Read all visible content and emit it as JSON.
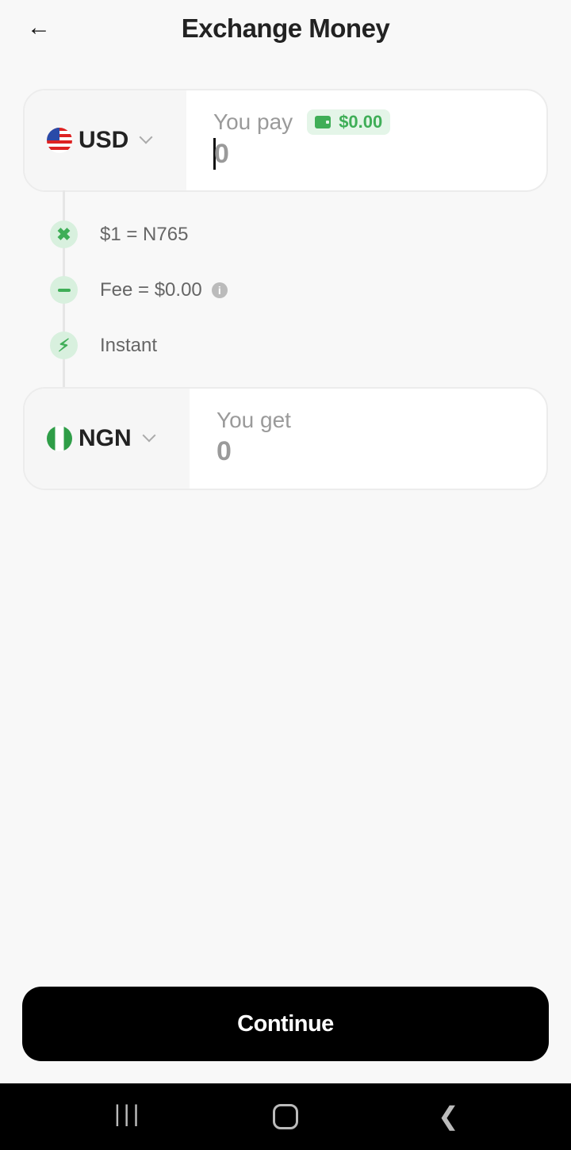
{
  "header": {
    "title": "Exchange Money",
    "back_icon": "arrow-left-icon"
  },
  "pay": {
    "currency": "USD",
    "label": "You pay",
    "balance": "$0.00",
    "value": "0"
  },
  "details": [
    {
      "icon": "close-icon",
      "text": "$1 = N765"
    },
    {
      "icon": "minus-icon",
      "text": "Fee = $0.00"
    },
    {
      "icon": "lightning-icon",
      "text": "Instant"
    }
  ],
  "get": {
    "currency": "NGN",
    "label": "You get",
    "value": "0"
  },
  "continue_label": "Continue",
  "colors": {
    "accent": "#3fae57",
    "button": "#000000"
  }
}
